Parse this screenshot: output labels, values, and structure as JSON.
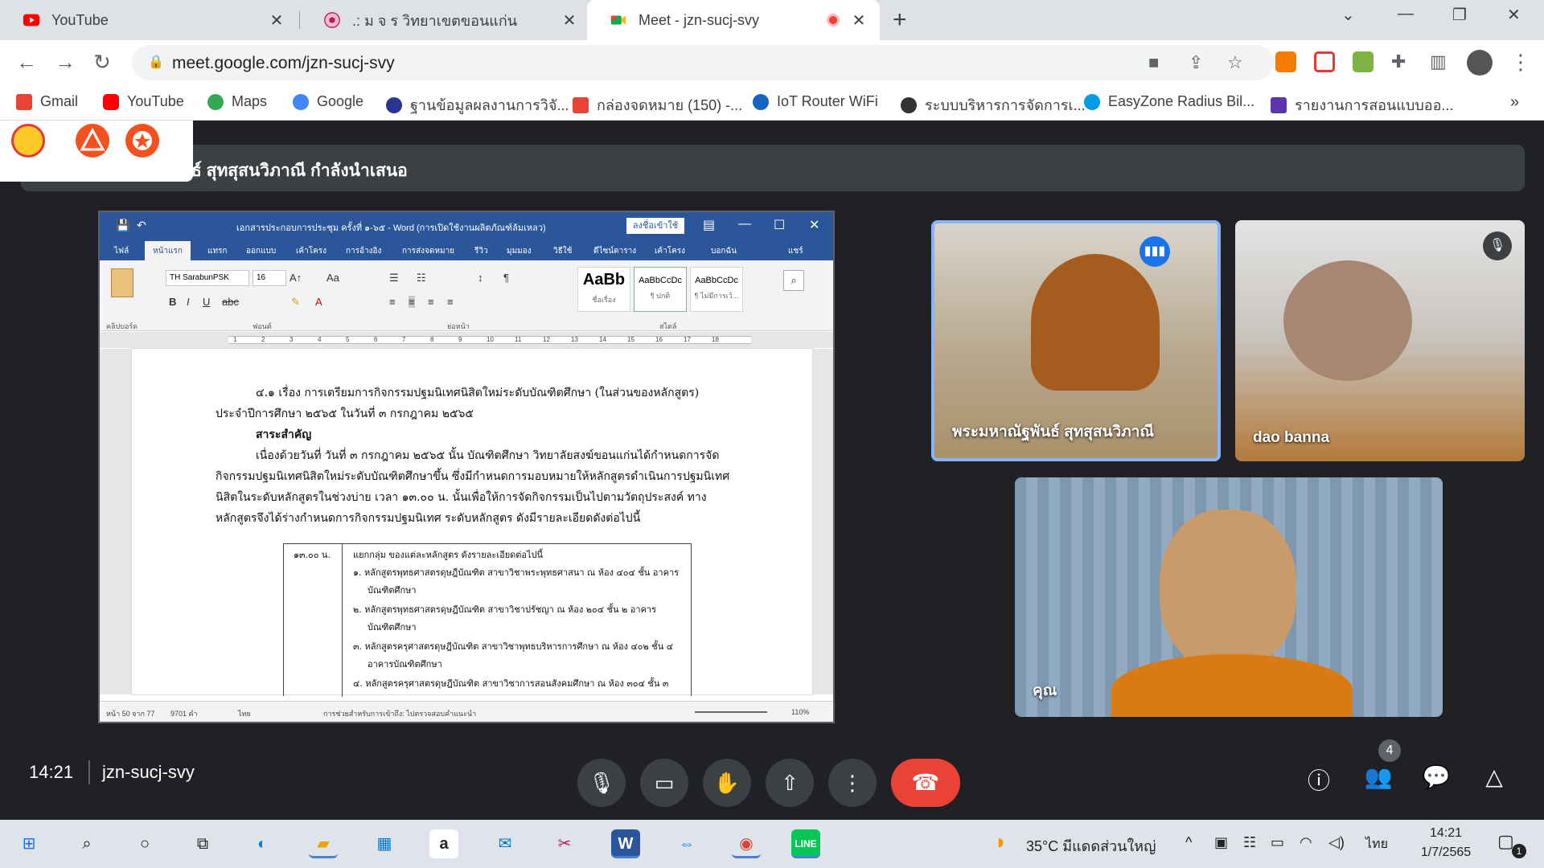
{
  "browser": {
    "tabs": [
      {
        "title": "YouTube",
        "icon": "youtube-icon"
      },
      {
        "title": ".: ม จ ร วิทยาเขตขอนแก่น",
        "icon": "site-icon"
      },
      {
        "title": "Meet - jzn-sucj-svy",
        "icon": "meet-icon",
        "active": true
      }
    ],
    "url": "meet.google.com/jzn-sucj-svy",
    "bookmarks": [
      {
        "label": "Gmail",
        "color": "#ea4335"
      },
      {
        "label": "YouTube",
        "color": "#ff0000"
      },
      {
        "label": "Maps",
        "color": "#34a853"
      },
      {
        "label": "Google",
        "color": "#4285f4"
      },
      {
        "label": "ฐานข้อมูลผลงานการวิจั...",
        "color": "#283593"
      },
      {
        "label": "กล่องจดหมาย (150) -...",
        "color": "#ea4335"
      },
      {
        "label": "IoT Router WiFi",
        "color": "#1565c0"
      },
      {
        "label": "ระบบบริหารการจัดการเ...",
        "color": "#333333"
      },
      {
        "label": "EasyZone Radius Bil...",
        "color": "#039be5"
      },
      {
        "label": "รายงานการสอนแบบออ...",
        "color": "#5e35b1"
      }
    ],
    "more_bookmarks": "»"
  },
  "meet": {
    "presenting_banner": "ธ์ สุทสุสนวิภาณี กำลังนำเสนอ",
    "participants": [
      {
        "name": "พระมหาณัฐพันธ์ สุทสุสนวิภาณี",
        "speaking": true
      },
      {
        "name": "dao banna",
        "muted": true
      },
      {
        "name": "คุณ"
      }
    ],
    "time": "14:21",
    "meeting_code": "jzn-sucj-svy",
    "participant_count": "4"
  },
  "word": {
    "title": "เอกสารประกอบการประชุม ครั้งที่ ๑-๖๕  -  Word (การเปิดใช้งานผลิตภัณฑ์ล้มเหลว)",
    "login_button": "ลงชื่อเข้าใช้",
    "ribbon_tabs": [
      "ไฟล์",
      "หน้าแรก",
      "แทรก",
      "ออกแบบ",
      "เค้าโครง",
      "การอ้างอิง",
      "การส่งจดหมาย",
      "รีวิว",
      "มุมมอง",
      "วิธีใช้",
      "ดีไซน์ตาราง",
      "เค้าโครง",
      "บอกฉัน",
      "แชร์"
    ],
    "font_name": "TH SarabunPSK",
    "font_size": "16",
    "styles": [
      {
        "preview": "AaBb",
        "name": "ชื่อเรื่อง"
      },
      {
        "preview": "AaBbCcDc",
        "name": "¶ ปกติ"
      },
      {
        "preview": "AaBbCcDc",
        "name": "¶ ไม่มีการเว้..."
      }
    ],
    "group_labels": [
      "คลิปบอร์ด",
      "ฟอนต์",
      "ย่อหน้า",
      "สไตล์"
    ],
    "ruler_marks": [
      "1",
      "2",
      "3",
      "4",
      "5",
      "6",
      "7",
      "8",
      "9",
      "10",
      "11",
      "12",
      "13",
      "14",
      "15",
      "16",
      "17",
      "18"
    ],
    "document_lines": [
      "๔.๑ เรื่อง การเตรียมการกิจกรรมปฐมนิเทศนิสิตใหม่ระดับบัณฑิตศึกษา (ในส่วนของหลักสูตร)",
      "ประจำปีการศึกษา ๒๕๖๕ ในวันที่ ๓ กรกฎาคม ๒๕๖๕",
      "สาระสำคัญ",
      "เนื่องด้วยวันที่ วันที่ ๓ กรกฎาคม ๒๕๖๕  นั้น บัณฑิตศึกษา วิทยาลัยสงฆ์ขอนแก่นได้กำหนดการจัด",
      "กิจกรรมปฐมนิเทศนิสิตใหม่ระดับบัณฑิตศึกษาขึ้น ซึ่งมีกำหนดการมอบหมายให้หลักสูตรดำเนินการปฐมนิเทศ",
      "นิสิตในระดับหลักสูตรในช่วงบ่าย เวลา ๑๓.๐๐ น. นั้นเพื่อให้การจัดกิจกรรมเป็นไปตามวัตถุประสงค์ ทาง",
      "หลักสูตรจึงได้ร่างกำหนดการกิจกรรมปฐมนิเทศ ระดับหลักสูตร ดังมีรายละเอียดดังต่อไปนี้"
    ],
    "table": {
      "time": "๑๓.๐๐ น.",
      "lines": [
        "แยกกลุ่ม ของแต่ละหลักสูตร ดังรายละเอียดต่อไปนี้",
        "๑.  หลักสูตรพุทธศาสตรดุษฎีบัณฑิต สาขาวิชาพระพุทธศาสนา ณ ห้อง ๔๐๔ ชั้น อาคาร",
        "บัณฑิตศึกษา",
        "๒.  หลักสูตรพุทธศาสตรดุษฎีบัณฑิต สาขาวิชาปรัชญา ณ ห้อง ๒๐๔ ชั้น ๒ อาคาร",
        "บัณฑิตศึกษา",
        "๓.  หลักสูตรครุศาสตรดุษฎีบัณฑิต สาขาวิชาพุทธบริหารการศึกษา ณ ห้อง ๔๐๒ ชั้น ๔",
        "อาคารบัณฑิตศึกษา",
        "๔.  หลักสูตรครุศาสตรดุษฎีบัณฑิต สาขาวิชาการสอนสังคมศึกษา ณ ห้อง ๓๐๔ ชั้น ๓"
      ]
    },
    "status": {
      "page": "หน้า 50 จาก 77",
      "words": "9701 คำ",
      "lang": "ไทย",
      "accessibility": "การช่วยสำหรับการเข้าถึง: ไปตรวจสอบคำแนะนำ",
      "zoom": "110%"
    }
  },
  "taskbar": {
    "weather": "35°C  มีแดดส่วนใหญ่",
    "lang": "ไทย",
    "time": "14:21",
    "date": "1/7/2565",
    "notification_count": "1"
  }
}
